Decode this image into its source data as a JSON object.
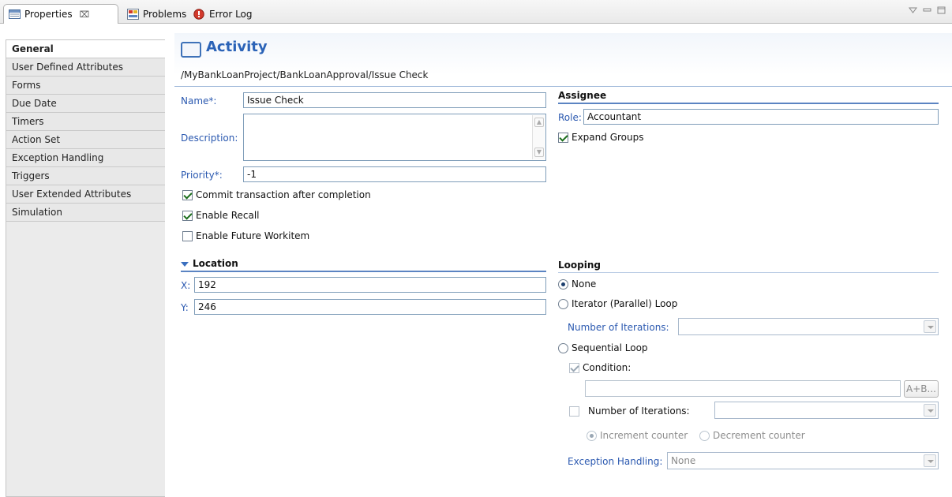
{
  "tabs": [
    {
      "label": "Properties",
      "icon": "properties-icon"
    },
    {
      "label": "Problems",
      "icon": "problems-icon"
    },
    {
      "label": "Error Log",
      "icon": "error-log-icon"
    }
  ],
  "tab_close_glyph": "⌧",
  "window_controls": [
    "view-menu-icon",
    "minimize-icon",
    "maximize-icon"
  ],
  "sidebar": {
    "items": [
      {
        "label": "General",
        "selected": true
      },
      {
        "label": "User Defined Attributes"
      },
      {
        "label": "Forms"
      },
      {
        "label": "Due Date"
      },
      {
        "label": "Timers"
      },
      {
        "label": "Action Set"
      },
      {
        "label": "Exception Handling"
      },
      {
        "label": "Triggers"
      },
      {
        "label": "User Extended Attributes"
      },
      {
        "label": "Simulation"
      }
    ]
  },
  "header": {
    "title": "Activity",
    "path": "/MyBankLoanProject/BankLoanApproval/Issue Check"
  },
  "general": {
    "name_label": "Name*:",
    "name_value": "Issue Check",
    "description_label": "Description:",
    "description_value": "",
    "priority_label": "Priority*:",
    "priority_value": "-1",
    "commit_label": "Commit transaction after completion",
    "commit_checked": true,
    "recall_label": "Enable Recall",
    "recall_checked": true,
    "future_label": "Enable Future Workitem",
    "future_checked": false
  },
  "assignee": {
    "heading": "Assignee",
    "role_label": "Role:",
    "role_value": "Accountant",
    "expand_label": "Expand Groups",
    "expand_checked": true
  },
  "location": {
    "heading": "Location",
    "x_label": "X:",
    "x_value": "192",
    "y_label": "Y:",
    "y_value": "246"
  },
  "looping": {
    "heading": "Looping",
    "none_label": "None",
    "iterator_label": "Iterator (Parallel) Loop",
    "num_iter_label": "Number of Iterations:",
    "num_iter_value": "",
    "sequential_label": "Sequential Loop",
    "condition_label": "Condition:",
    "condition_value": "",
    "expr_button": "A+B...",
    "seq_num_iter_label": "Number of Iterations:",
    "seq_num_iter_value": "",
    "increment_label": "Increment counter",
    "decrement_label": "Decrement counter",
    "exception_label": "Exception Handling:",
    "exception_value": "None",
    "selected": "None"
  },
  "colors": {
    "accent": "#2b63b7",
    "label_blue": "#2b59b0",
    "section_line": "#5b84c2"
  }
}
